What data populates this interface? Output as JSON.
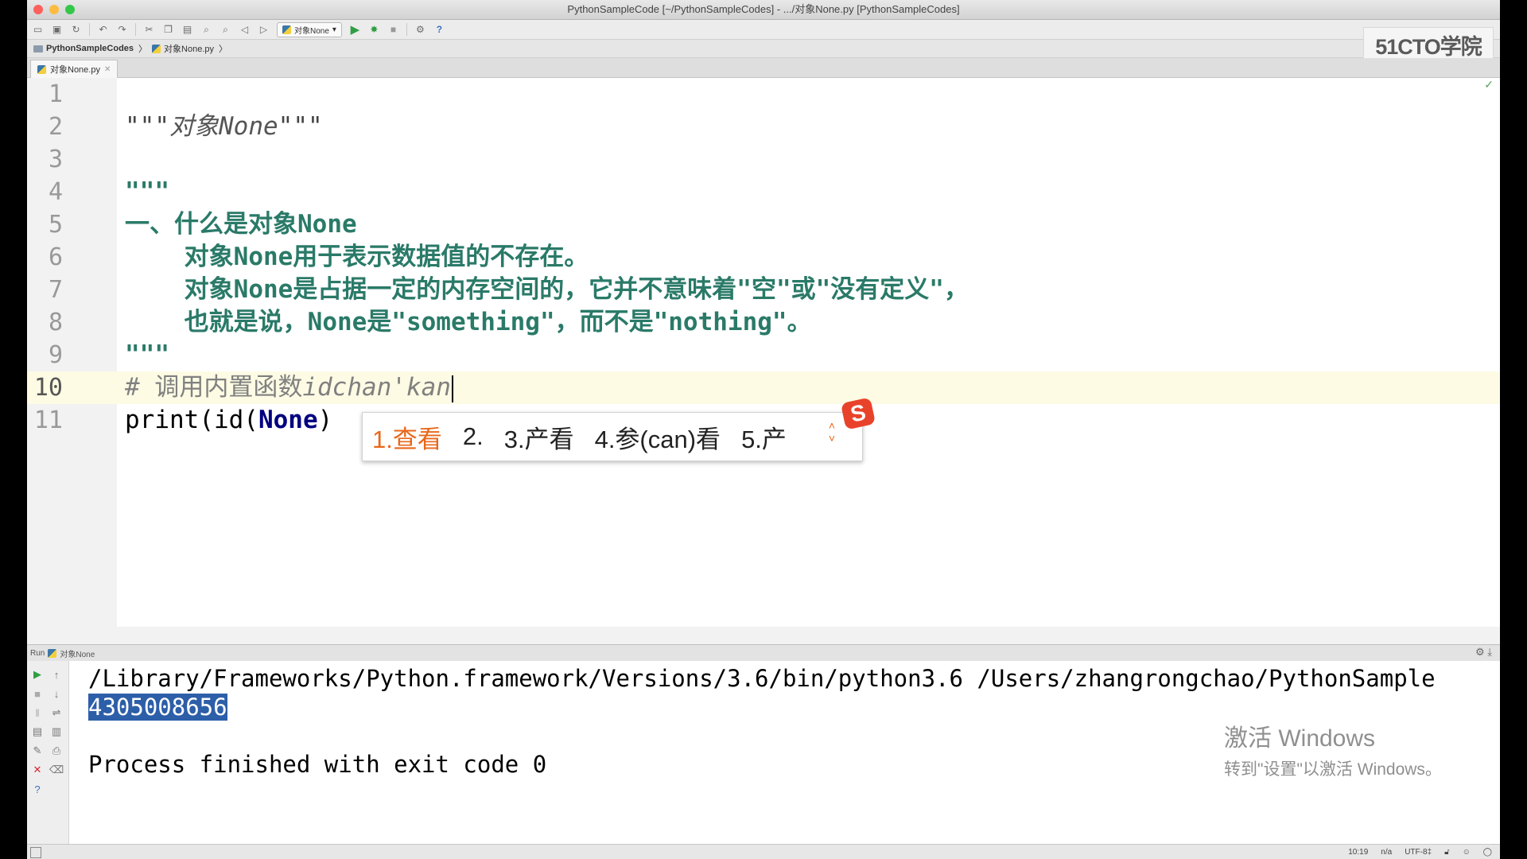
{
  "window": {
    "title": "PythonSampleCode [~/PythonSampleCodes] - .../对象None.py [PythonSampleCodes]"
  },
  "toolbar": {
    "run_config": "对象None"
  },
  "breadcrumb": {
    "project": "PythonSampleCodes",
    "file": "对象None.py"
  },
  "logo": "51CTO学院",
  "tab": {
    "label": "对象None.py"
  },
  "editor": {
    "line_numbers": [
      "1",
      "2",
      "3",
      "4",
      "5",
      "6",
      "7",
      "8",
      "9",
      "10",
      "11"
    ],
    "current_line": 10,
    "lines": {
      "l2_q1": "\"\"\"",
      "l2_text": "对象None",
      "l2_q2": "\"\"\"",
      "l4": "\"\"\"",
      "l5": "一、什么是对象None",
      "l6": "    对象None用于表示数据值的不存在。",
      "l7": "    对象None是占据一定的内存空间的，它并不意味着\"空\"或\"没有定义\"，",
      "l8": "    也就是说，None是\"something\"，而不是\"nothing\"。",
      "l9": "\"\"\"",
      "l10_hash": "# 调用内置函数",
      "l10_typed": "idchan'kan",
      "l11_pre": "print(id(",
      "l11_kw": "None",
      "l11_post": ")"
    }
  },
  "ime": {
    "candidates": [
      "1.查看",
      "2.",
      "3.产看",
      "4.参(can)看",
      "5.产"
    ],
    "logo": "S"
  },
  "run_panel": {
    "header": "Run",
    "config": "对象None",
    "output": {
      "command": "/Library/Frameworks/Python.framework/Versions/3.6/bin/python3.6 /Users/zhangrongchao/PythonSample",
      "result": "4305008656",
      "finish": "Process finished with exit code 0"
    }
  },
  "watermark": {
    "line1": "激活 Windows",
    "line2": "转到\"设置\"以激活 Windows。"
  },
  "status": {
    "position": "10:19",
    "na": "n/a",
    "encoding": "UTF-8‡"
  }
}
